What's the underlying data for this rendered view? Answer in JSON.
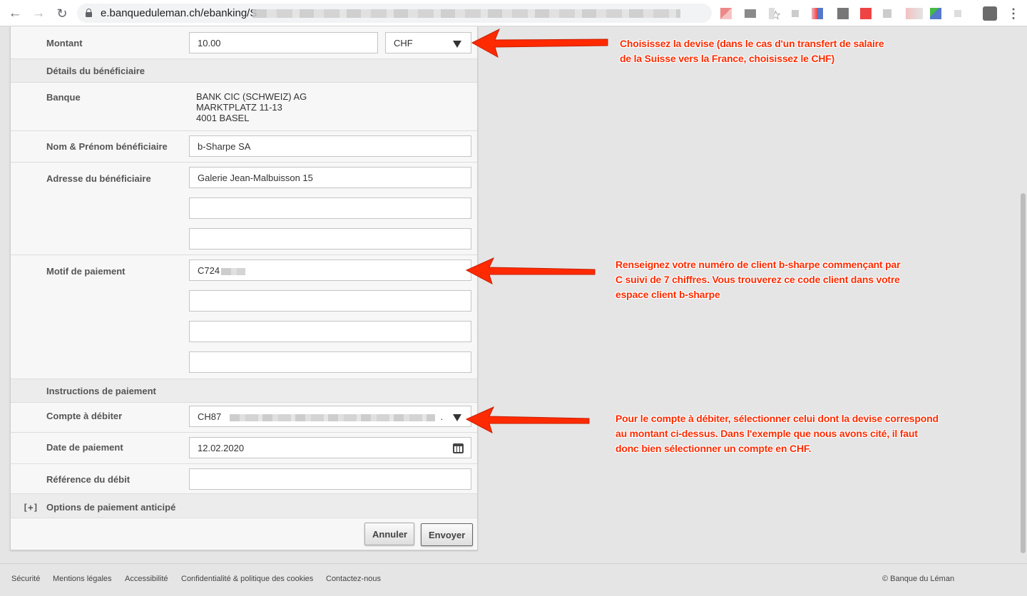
{
  "browser": {
    "url": "e.banqueduleman.ch/ebanking/",
    "url_tail": "S"
  },
  "form": {
    "montant": {
      "label": "Montant",
      "value": "10.00",
      "currency": "CHF"
    },
    "beneficiary_section": "Détails du bénéficiaire",
    "banque": {
      "label": "Banque",
      "lines": [
        "BANK CIC (SCHWEIZ) AG",
        "MARKTPLATZ 11-13",
        "4001 BASEL"
      ]
    },
    "nom": {
      "label": "Nom & Prénom bénéficiaire",
      "value": "b-Sharpe SA"
    },
    "adresse": {
      "label": "Adresse du bénéficiaire",
      "line1": "Galerie Jean-Malbuisson 15",
      "line2": "",
      "line3": ""
    },
    "motif": {
      "label": "Motif de paiement",
      "line1": "C724",
      "line2": "",
      "line3": "",
      "line4": ""
    },
    "instructions_section": "Instructions de paiement",
    "compte": {
      "label": "Compte à débiter",
      "value_prefix": "CH87",
      "value_suffix": "."
    },
    "date": {
      "label": "Date de paiement",
      "value": "12.02.2020"
    },
    "reference": {
      "label": "Référence du débit",
      "value": ""
    },
    "options": {
      "label": "Options de paiement anticipé",
      "icon": "[+]"
    },
    "buttons": {
      "cancel": "Annuler",
      "submit": "Envoyer"
    }
  },
  "footer": {
    "links": [
      "Sécurité",
      "Mentions légales",
      "Accessibilité",
      "Confidentialité & politique des cookies",
      "Contactez-nous"
    ],
    "copyright": "© Banque du Léman"
  },
  "annotations": {
    "devise": [
      "Choisissez la devise (dans le cas d'un transfert de salaire",
      "de la Suisse vers la France, choisissez le CHF)"
    ],
    "motif": [
      "Renseignez votre numéro de client b-sharpe commençant par",
      "C suivi de 7 chiffres. Vous trouverez ce code client dans votre",
      "espace client b-sharpe"
    ],
    "compte": [
      "Pour le compte à débiter, sélectionner celui dont la devise correspond",
      "au montant ci-dessus. Dans l'exemple que nous avons cité, il faut",
      "donc bien sélectionner un compte en CHF."
    ],
    "color": "#ff2a00"
  }
}
